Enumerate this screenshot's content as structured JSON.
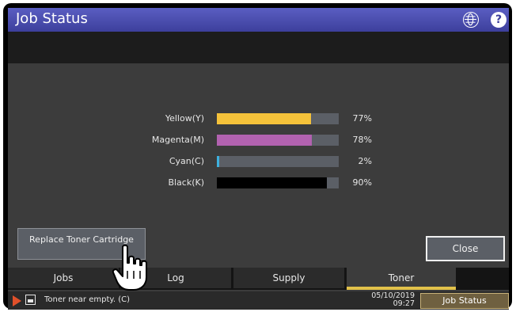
{
  "header": {
    "title": "Job Status",
    "icons": [
      "globe-icon",
      "help-icon"
    ]
  },
  "toner": {
    "items": [
      {
        "label": "Yellow(Y)",
        "percent_text": "77%",
        "level": 0.77,
        "color": "#f5c23a"
      },
      {
        "label": "Magenta(M)",
        "percent_text": "78%",
        "level": 0.78,
        "color": "#b262b0"
      },
      {
        "label": "Cyan(C)",
        "percent_text": "2%",
        "level": 0.02,
        "color": "#3db1df"
      },
      {
        "label": "Black(K)",
        "percent_text": "90%",
        "level": 0.9,
        "color": "#000000"
      }
    ]
  },
  "buttons": {
    "replace_toner": "Replace Toner Cartridge",
    "close": "Close"
  },
  "tabs": [
    {
      "label": "Jobs",
      "active": false
    },
    {
      "label": "Log",
      "active": false
    },
    {
      "label": "Supply",
      "active": false
    },
    {
      "label": "Toner",
      "active": true
    }
  ],
  "statusbar": {
    "message": "Toner near empty. (C)",
    "date": "05/10/2019",
    "time": "09:27",
    "job_status_button": "Job Status"
  },
  "colors": {
    "title_bar": "#4a4db0",
    "active_tab_underline": "#e2c24a",
    "alert": "#e0502a"
  }
}
